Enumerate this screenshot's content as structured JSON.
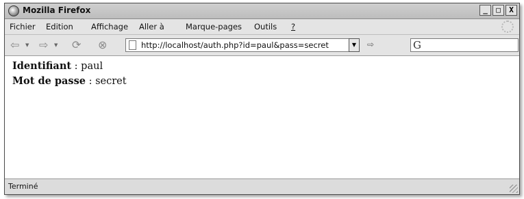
{
  "window": {
    "title": "Mozilla Firefox",
    "controls": {
      "minimize": "_",
      "maximize": "□",
      "close": "X"
    }
  },
  "menu": {
    "items": [
      "Fichier",
      "Edition",
      "Affichage",
      "Aller à",
      "Marque-pages",
      "Outils",
      "?"
    ]
  },
  "toolbar": {
    "back_icon": "back-arrow-icon",
    "forward_icon": "forward-arrow-icon",
    "reload_icon": "reload-icon",
    "stop_icon": "stop-icon",
    "url": "http://localhost/auth.php?id=paul&pass=secret",
    "go_icon": "go-icon",
    "search_engine_glyph": "G",
    "search_value": ""
  },
  "page": {
    "line1_label": "Identifiant",
    "line1_value": " : paul",
    "line2_label": "Mot de passe",
    "line2_value": " : secret"
  },
  "status": {
    "text": "Terminé"
  }
}
